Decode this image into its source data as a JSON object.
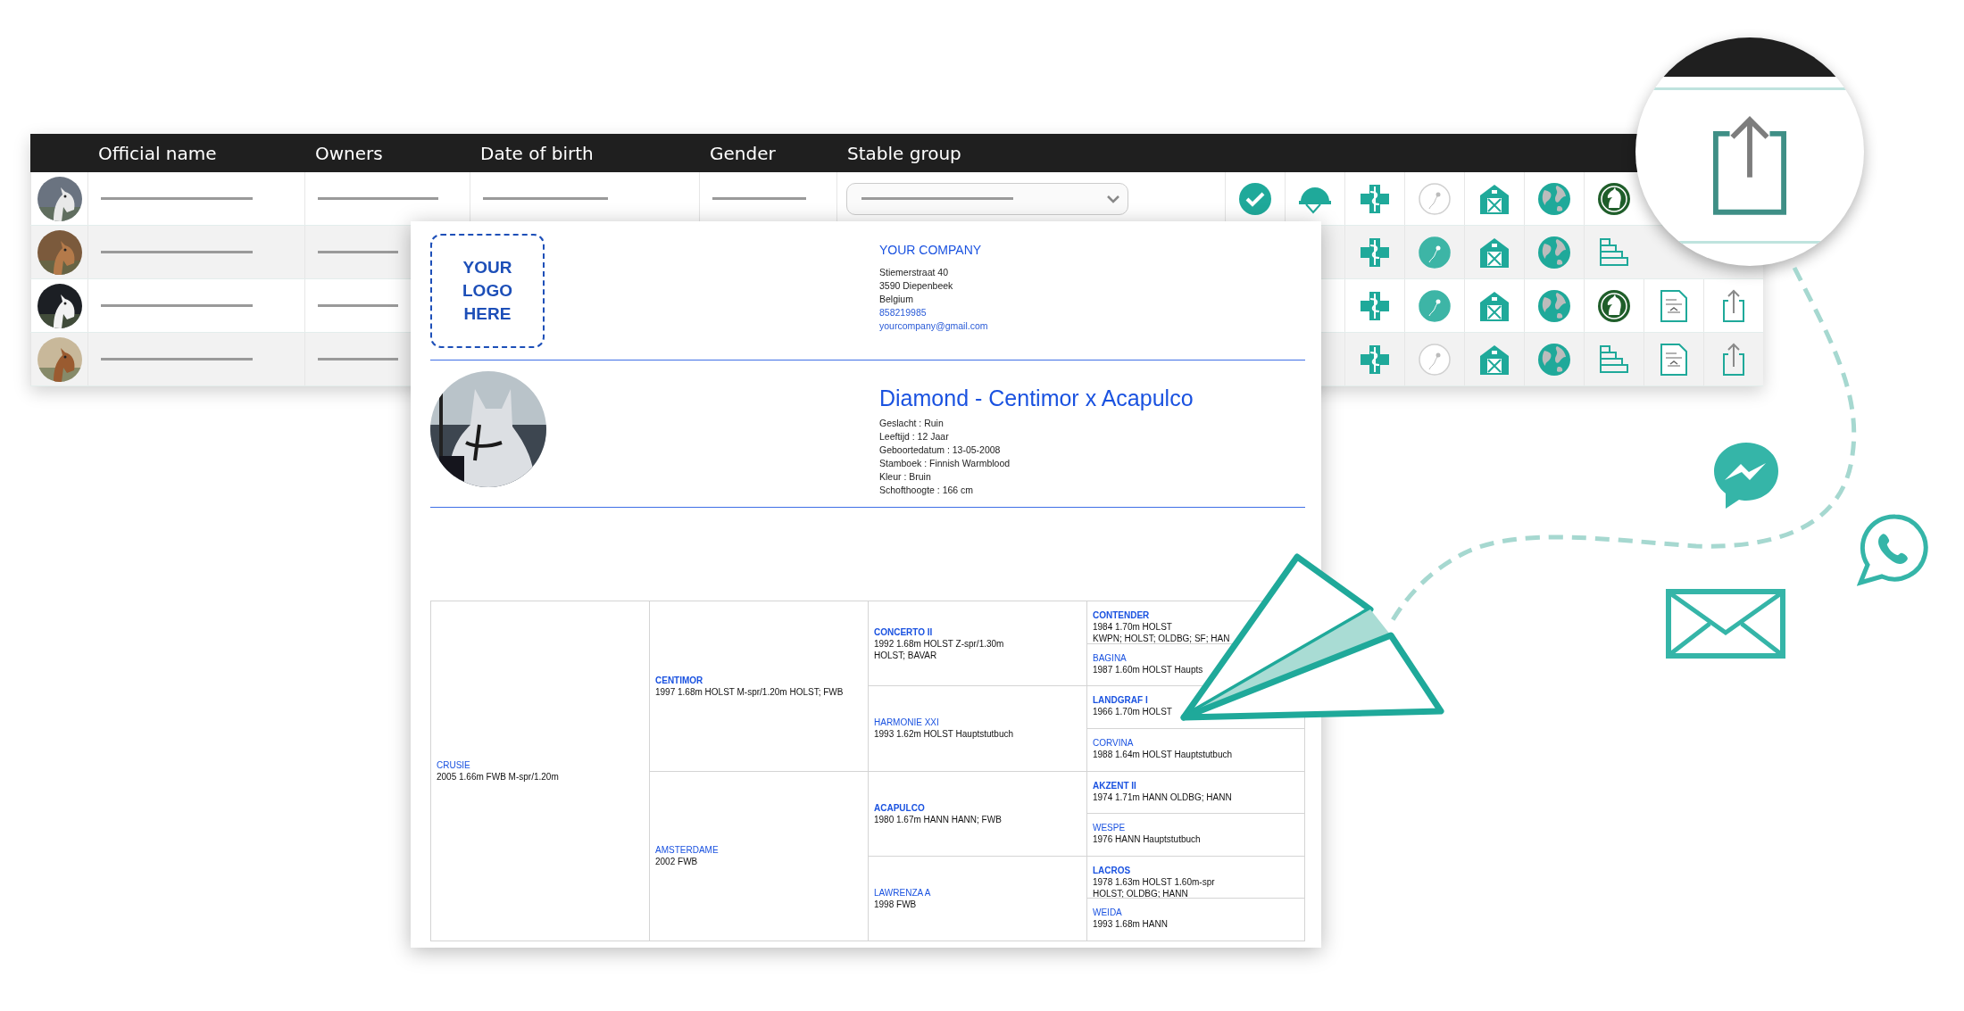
{
  "table": {
    "columns": [
      "Official name",
      "Owners",
      "Date of birth",
      "Gender",
      "Stable group"
    ],
    "rows": [
      {
        "icons": [
          {
            "kind": "check"
          },
          {
            "kind": "helmet"
          },
          {
            "kind": "medical"
          },
          {
            "kind": "fertility",
            "on": false
          },
          {
            "kind": "barn"
          },
          {
            "kind": "globe"
          },
          {
            "kind": "horse"
          }
        ]
      },
      {
        "icons": [
          {
            "kind": "medical"
          },
          {
            "kind": "fertility",
            "on": true
          },
          {
            "kind": "barn"
          },
          {
            "kind": "globe"
          },
          {
            "kind": "bars"
          }
        ]
      },
      {
        "icons": [
          {
            "kind": "medical"
          },
          {
            "kind": "fertility",
            "on": true
          },
          {
            "kind": "barn"
          },
          {
            "kind": "globe"
          },
          {
            "kind": "horse"
          },
          {
            "kind": "document"
          },
          {
            "kind": "share"
          }
        ]
      },
      {
        "icons": [
          {
            "kind": "medical"
          },
          {
            "kind": "fertility",
            "on": false
          },
          {
            "kind": "barn"
          },
          {
            "kind": "globe"
          },
          {
            "kind": "bars"
          },
          {
            "kind": "document"
          },
          {
            "kind": "share"
          }
        ]
      }
    ]
  },
  "document": {
    "logo": "YOUR LOGO HERE",
    "company": {
      "name": "YOUR COMPANY",
      "address": [
        "Stiemerstraat 40",
        "3590 Diepenbeek",
        "Belgium"
      ],
      "phone": "858219985",
      "email": "yourcompany@gmail.com"
    },
    "horse": {
      "title": "Diamond - Centimor x Acapulco",
      "details": [
        "Geslacht : Ruin",
        "Leeftijd : 12 Jaar",
        "Geboortedatum : 13-05-2008",
        "Stamboek : Finnish Warmblood",
        "Kleur : Bruin",
        "Schofthoogte : 166 cm"
      ]
    },
    "pedigree": {
      "name": "CRUSIE",
      "kind": "mare",
      "lines": [
        "2005 1.66m FWB M-spr/1.20m"
      ],
      "children": [
        {
          "name": "CENTIMOR",
          "kind": "stallion",
          "lines": [
            "1997 1.68m HOLST M-spr/1.20m HOLST; FWB"
          ],
          "children": [
            {
              "name": "CONCERTO II",
              "kind": "stallion",
              "lines": [
                "1992 1.68m HOLST Z-spr/1.30m",
                "HOLST; BAVAR"
              ],
              "children": [
                {
                  "name": "CONTENDER",
                  "kind": "stallion",
                  "lines": [
                    "1984 1.70m HOLST",
                    "KWPN; HOLST; OLDBG; SF; HAN"
                  ]
                },
                {
                  "name": "BAGINA",
                  "kind": "mare",
                  "lines": [
                    "1987 1.60m HOLST Haupts"
                  ]
                }
              ]
            },
            {
              "name": "HARMONIE XXI",
              "kind": "mare",
              "lines": [
                "1993 1.62m HOLST Hauptstutbuch"
              ],
              "children": [
                {
                  "name": "LANDGRAF I",
                  "kind": "stallion",
                  "lines": [
                    "1966 1.70m HOLST"
                  ]
                },
                {
                  "name": "CORVINA",
                  "kind": "mare",
                  "lines": [
                    "1988 1.64m HOLST Hauptstutbuch"
                  ]
                }
              ]
            }
          ]
        },
        {
          "name": "AMSTERDAME",
          "kind": "mare",
          "lines": [
            "2002 FWB"
          ],
          "children": [
            {
              "name": "ACAPULCO",
              "kind": "stallion",
              "lines": [
                "1980 1.67m HANN HANN; FWB"
              ],
              "children": [
                {
                  "name": "AKZENT II",
                  "kind": "stallion",
                  "lines": [
                    "1974 1.71m HANN OLDBG; HANN"
                  ]
                },
                {
                  "name": "WESPE",
                  "kind": "mare",
                  "lines": [
                    "1976 HANN Hauptstutbuch"
                  ]
                }
              ]
            },
            {
              "name": "LAWRENZA A",
              "kind": "mare",
              "lines": [
                "1998 FWB"
              ],
              "children": [
                {
                  "name": "LACROS",
                  "kind": "stallion",
                  "lines": [
                    "1978 1.63m HOLST 1.60m-spr",
                    "HOLST; OLDBG; HANN"
                  ]
                },
                {
                  "name": "WEIDA",
                  "kind": "mare",
                  "lines": [
                    "1993 1.68m HANN"
                  ]
                }
              ]
            }
          ]
        }
      ]
    }
  }
}
